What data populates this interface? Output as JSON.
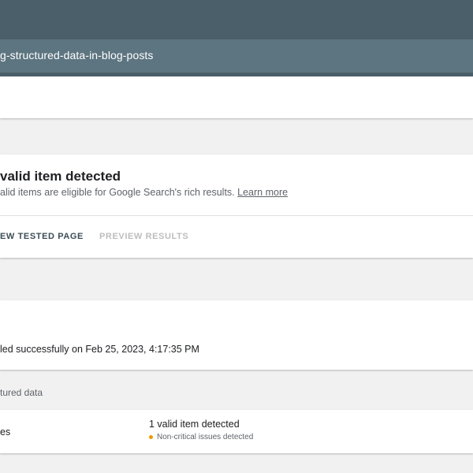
{
  "browser": {
    "url": "g-structured-data-in-blog-posts"
  },
  "result": {
    "title": "valid item detected",
    "subtitle": "alid items are eligible for Google Search's rich results.",
    "learn_more": "Learn more",
    "actions": {
      "view_tested_page": "EW TESTED PAGE",
      "preview_results": "PREVIEW RESULTS"
    }
  },
  "crawl": {
    "status_text": "led successfully on Feb 25, 2023, 4:17:35 PM"
  },
  "structured_data": {
    "section_label": "tured data",
    "row": {
      "label": "es",
      "status": "1 valid item detected",
      "note": "Non-critical issues detected",
      "note_color": "#f29900"
    }
  }
}
